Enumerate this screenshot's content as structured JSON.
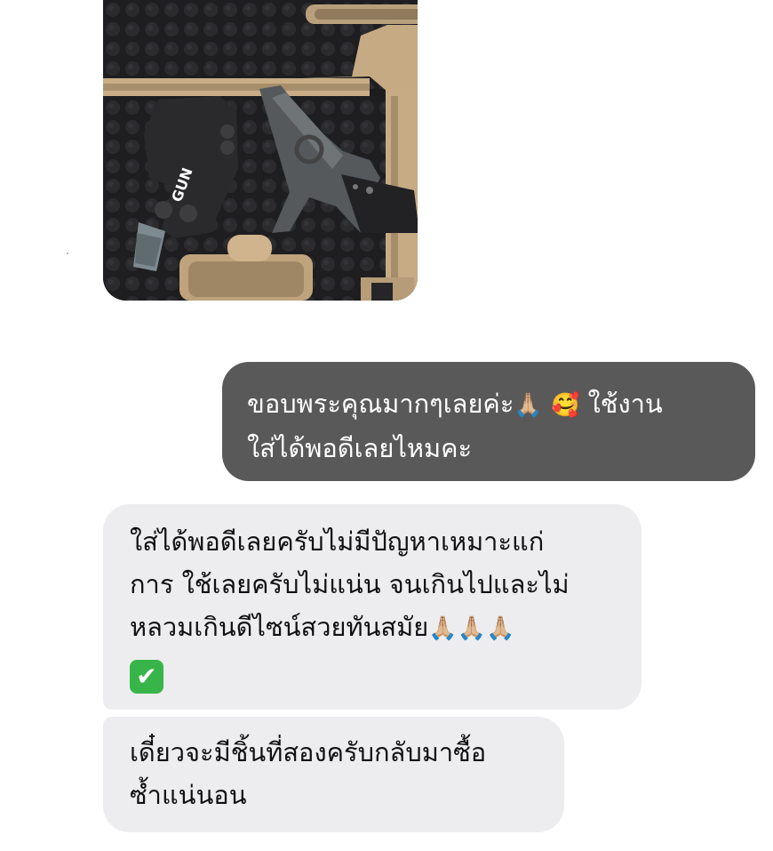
{
  "chat": {
    "photo": {
      "description_icon": "photo-icon"
    },
    "messages": [
      {
        "direction": "outgoing",
        "lines": [
          "ขอบพระคุณมากๆเลยค่ะ",
          "ใส่ได้พอดีเลยไหมคะ"
        ],
        "line1_suffix": "ใช้งาน",
        "emojis": [
          "🙏🏼",
          "🥰"
        ]
      },
      {
        "direction": "incoming",
        "lines": [
          "ใส่ได้พอดีเลยครับไม่มีปัญหาเหมาะแก่",
          "การ ใช้เลยครับไม่แน่น จนเกินไปและไม่",
          "หลวมเกินดีไซน์สวยทันสมัย"
        ],
        "emojis": [
          "🙏🏼🙏🏼🙏🏼",
          "✔"
        ]
      },
      {
        "direction": "incoming",
        "lines": [
          "เดี๋ยวจะมีชิ้นที่สองครับกลับมาซื้อ",
          "ซ้ำแน่นอน"
        ]
      }
    ],
    "colors": {
      "outgoing_bg": "#595959",
      "incoming_bg": "#ededf0",
      "accent_check": "#38b54a"
    }
  }
}
